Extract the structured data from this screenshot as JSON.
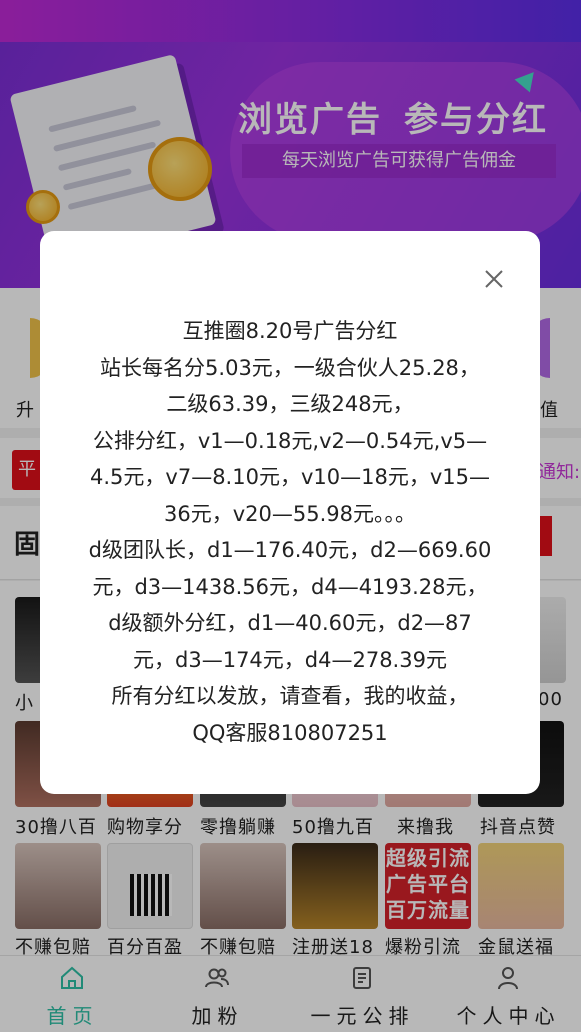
{
  "banner": {
    "title_left": "浏览广告",
    "title_right": "参与分红",
    "subtitle": "每天浏览广告可获得广告佣金"
  },
  "icon_row": {
    "left_label": "升",
    "right_label": "值"
  },
  "notice": {
    "tag": "平",
    "text": "通知:"
  },
  "section": {
    "title": "固"
  },
  "grid": {
    "row1": [
      "小",
      "",
      "",
      "",
      "",
      "00"
    ],
    "row2": [
      "30撸八百",
      "购物享分",
      "零撸躺赚",
      "50撸九百",
      "来撸我",
      "抖音点赞"
    ],
    "row3": [
      "不赚包赔",
      "百分百盈",
      "不赚包赔",
      "注册送18",
      "爆粉引流",
      "金鼠送福"
    ],
    "promo_lines": [
      "超级引流",
      "广告平台",
      "百万流量"
    ]
  },
  "nav": {
    "items": [
      {
        "label": "首页",
        "icon": "home-icon",
        "active": true
      },
      {
        "label": "加粉",
        "icon": "users-icon",
        "active": false
      },
      {
        "label": "一元公排",
        "icon": "document-icon",
        "active": false
      },
      {
        "label": "个人中心",
        "icon": "user-icon",
        "active": false
      }
    ],
    "active_color": "#2ebfa5"
  },
  "modal": {
    "lines": [
      "互推圈8.20号广告分红",
      "站长每名分5.03元，一级合伙人25.28，",
      "二级63.39，三级248元，",
      "公排分红，v1—0.18元,v2—0.54元,v5—",
      "4.5元，v7—8.10元，v10—18元，v15—",
      "36元，v20—55.98元。。。",
      "d级团队长，d1—176.40元，d2—669.60",
      "元，d3—1438.56元，d4—4193.28元，",
      "d级额外分红，d1—40.60元，d2—87",
      "元，d3—174元，d4—278.39元",
      "所有分红以发放，请查看，我的收益，",
      "QQ客服810807251"
    ]
  }
}
